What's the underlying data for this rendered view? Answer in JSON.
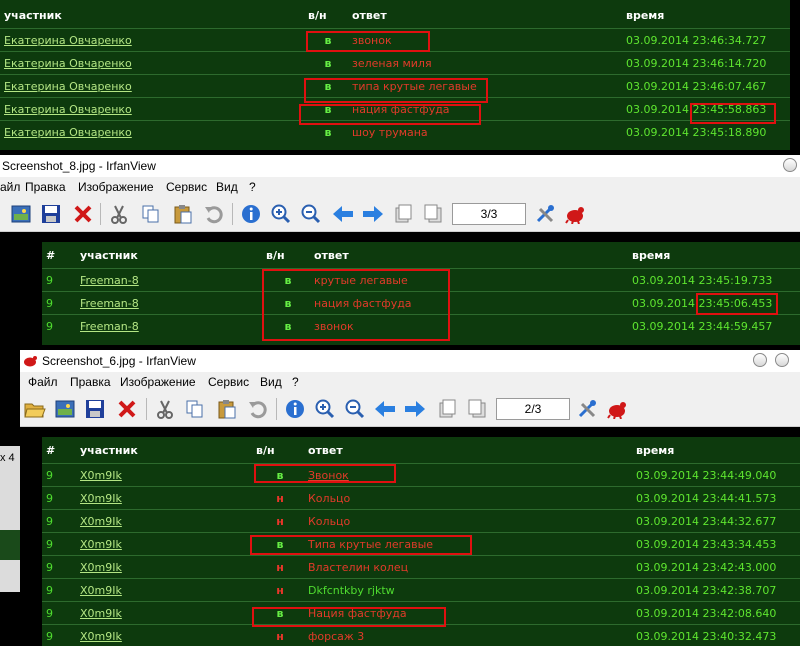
{
  "top_table": {
    "headers": {
      "participant": "участник",
      "yn": "в/н",
      "answer": "ответ",
      "time": "время"
    },
    "rows": [
      {
        "participant": "Екатерина Овчаренко",
        "yn": "в",
        "answer": "звонок",
        "time": "03.09.2014 23:46:34.727"
      },
      {
        "participant": "Екатерина Овчаренко",
        "yn": "в",
        "answer": "зеленая миля",
        "time": "03.09.2014 23:46:14.720"
      },
      {
        "participant": "Екатерина Овчаренко",
        "yn": "в",
        "answer": "типа крутые легавые",
        "time": "03.09.2014 23:46:07.467"
      },
      {
        "participant": "Екатерина Овчаренко",
        "yn": "в",
        "answer": "нация фастфуда",
        "time_date": "03.09.2014",
        "time_clock": "23:45:58.863"
      },
      {
        "participant": "Екатерина Овчаренко",
        "yn": "в",
        "answer": "шоу трумана",
        "time": "03.09.2014 23:45:18.890"
      }
    ]
  },
  "window2": {
    "title": "Screenshot_8.jpg - IrfanView",
    "menu": [
      "айл",
      "Правка",
      "Изображение",
      "Сервис",
      "Вид",
      "?"
    ],
    "page": "3/3",
    "headers": {
      "num": "#",
      "participant": "участник",
      "yn": "в/н",
      "answer": "ответ",
      "time": "время"
    },
    "rows": [
      {
        "num": "9",
        "participant": "Freeman-8",
        "yn": "в",
        "answer": "крутые легавые",
        "time": "03.09.2014 23:45:19.733"
      },
      {
        "num": "9",
        "participant": "Freeman-8",
        "yn": "в",
        "answer": "нация фастфуда",
        "time_date": "03.09.2014",
        "time_clock": "23:45:06.453"
      },
      {
        "num": "9",
        "participant": "Freeman-8",
        "yn": "в",
        "answer": "звонок",
        "time": "03.09.2014 23:44:59.457"
      }
    ]
  },
  "window3": {
    "title": "Screenshot_6.jpg - IrfanView",
    "menu": [
      "Файл",
      "Правка",
      "Изображение",
      "Сервис",
      "Вид",
      "?"
    ],
    "page": "2/3",
    "side_text": "x 4",
    "headers": {
      "num": "#",
      "participant": "участник",
      "yn": "в/н",
      "answer": "ответ",
      "time": "время"
    },
    "rows": [
      {
        "num": "9",
        "participant": "X0m9Ik",
        "yn": "в",
        "answer": "Звонок",
        "time": "03.09.2014 23:44:49.040"
      },
      {
        "num": "9",
        "participant": "X0m9Ik",
        "yn": "н",
        "answer": "Кольцо",
        "time": "03.09.2014 23:44:41.573"
      },
      {
        "num": "9",
        "participant": "X0m9Ik",
        "yn": "н",
        "answer": "Кольцо",
        "time": "03.09.2014 23:44:32.677"
      },
      {
        "num": "9",
        "participant": "X0m9Ik",
        "yn": "в",
        "answer": "Типа крутые легавые",
        "time": "03.09.2014 23:43:34.453"
      },
      {
        "num": "9",
        "participant": "X0m9Ik",
        "yn": "н",
        "answer": "Властелин колец",
        "time": "03.09.2014 23:42:43.000"
      },
      {
        "num": "9",
        "participant": "X0m9Ik",
        "yn": "н",
        "answer": "Dkfcntkby rjktw",
        "time": "03.09.2014 23:42:38.707"
      },
      {
        "num": "9",
        "participant": "X0m9Ik",
        "yn": "в",
        "answer": "Нация фастфуда",
        "time": "03.09.2014 23:42:08.640"
      },
      {
        "num": "9",
        "participant": "X0m9Ik",
        "yn": "н",
        "answer": "форсаж 3",
        "time": "03.09.2014 23:40:32.473"
      }
    ]
  },
  "colors": {
    "panel_bg": "#0d3a0d",
    "highlight": "#e01010",
    "answer_red": "#e23b2a",
    "time_green": "#5ee52f"
  }
}
